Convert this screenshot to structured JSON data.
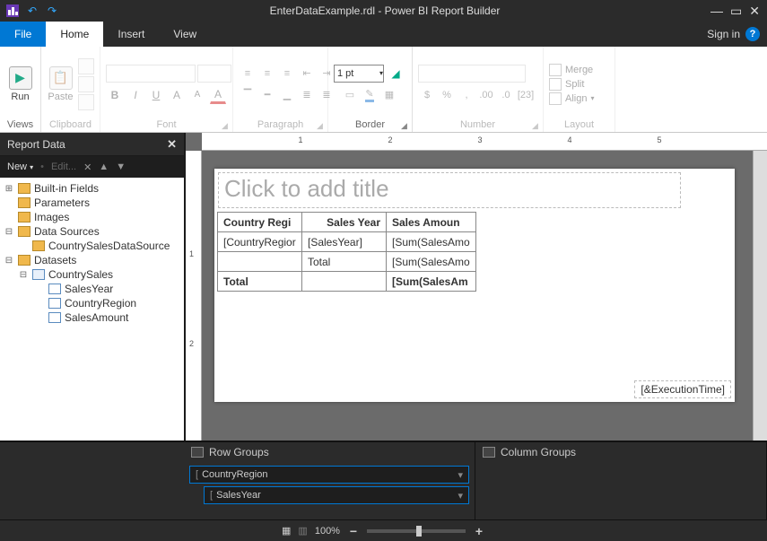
{
  "titlebar": {
    "title": "EnterDataExample.rdl - Power BI Report Builder"
  },
  "menu": {
    "file": "File",
    "home": "Home",
    "insert": "Insert",
    "view": "View",
    "signin": "Sign in"
  },
  "ribbon": {
    "views": {
      "label": "Views",
      "run": "Run"
    },
    "clipboard": {
      "label": "Clipboard",
      "paste": "Paste"
    },
    "font": {
      "label": "Font",
      "bold": "B",
      "italic": "I",
      "underline": "U"
    },
    "paragraph": {
      "label": "Paragraph"
    },
    "border": {
      "label": "Border",
      "pt": "1 pt"
    },
    "number": {
      "label": "Number"
    },
    "layout": {
      "label": "Layout",
      "merge": "Merge",
      "split": "Split",
      "align": "Align"
    }
  },
  "reportdata": {
    "title": "Report Data",
    "new": "New",
    "edit": "Edit...",
    "nodes": {
      "builtin": "Built-in Fields",
      "parameters": "Parameters",
      "images": "Images",
      "datasources": "Data Sources",
      "ds_item": "CountrySalesDataSource",
      "datasets": "Datasets",
      "dataset1": "CountrySales",
      "f1": "SalesYear",
      "f2": "CountryRegion",
      "f3": "SalesAmount"
    }
  },
  "design": {
    "title_placeholder": "Click to add title",
    "headers": {
      "c1": "Country Regi",
      "c2": "Sales Year",
      "c3": "Sales Amoun"
    },
    "row1": {
      "c1": "[CountryRegior",
      "c2": "[SalesYear]",
      "c3": "[Sum(SalesAmo"
    },
    "row2": {
      "c1": "",
      "c2": "Total",
      "c3": "[Sum(SalesAmo"
    },
    "row3": {
      "c1": "Total",
      "c2": "",
      "c3": "[Sum(SalesAm"
    },
    "exec": "[&ExecutionTime]"
  },
  "groups": {
    "row_label": "Row Groups",
    "col_label": "Column Groups",
    "rg1": "CountryRegion",
    "rg2": "SalesYear"
  },
  "status": {
    "zoom": "100%"
  },
  "ruler": {
    "n1": "1",
    "n2": "2",
    "n3": "3",
    "n4": "4",
    "n5": "5"
  }
}
